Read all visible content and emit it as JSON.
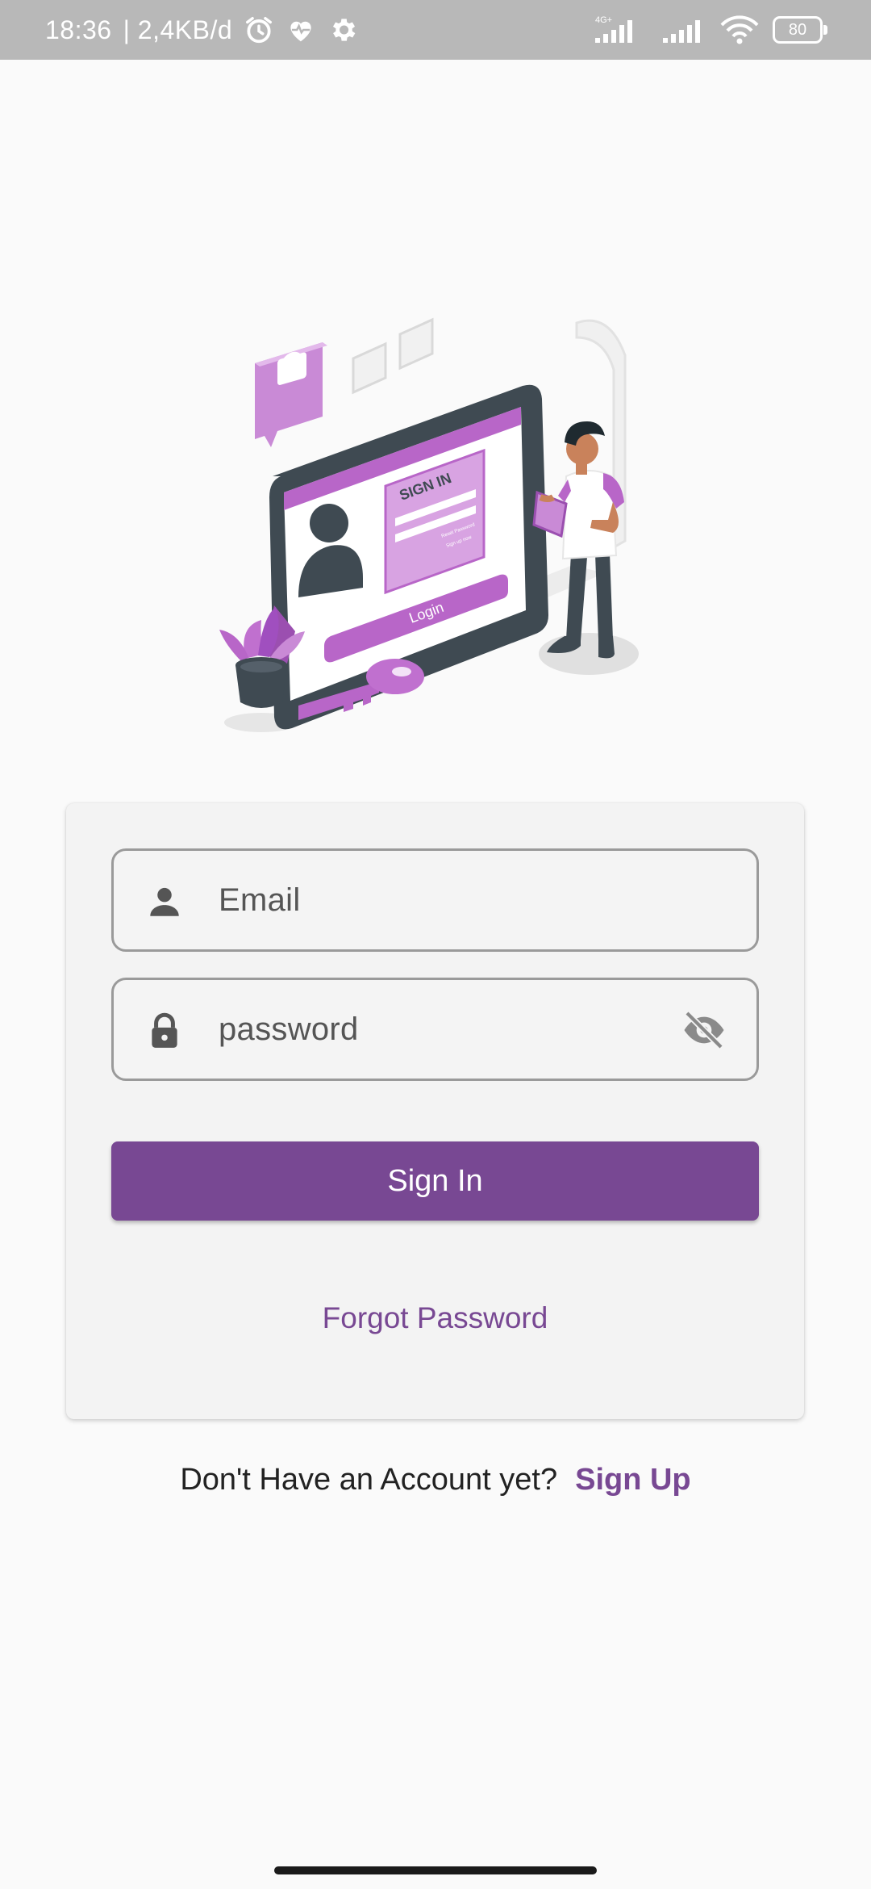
{
  "status_bar": {
    "time": "18:36",
    "net_speed": "| 2,4KB/d",
    "network_type": "4G+",
    "battery": "80",
    "icons": [
      "alarm-icon",
      "heart-health-icon",
      "gear-icon",
      "signal-icon",
      "signal-icon",
      "wifi-icon",
      "battery-icon"
    ]
  },
  "illustration": {
    "sign_in_heading": "SIGN IN",
    "login_label": "Login",
    "reset_text": "Reset Password",
    "signup_text": "Sign up now"
  },
  "login_form": {
    "email_placeholder": "Email",
    "password_placeholder": "password",
    "sign_in_label": "Sign In",
    "forgot_password_label": "Forgot Password"
  },
  "footer": {
    "prompt": "Don't Have an Account yet?",
    "sign_up_label": "Sign Up"
  },
  "colors": {
    "accent": "#784893",
    "illustration_purple": "#b866c8",
    "status_bar": "#b8b8b8"
  }
}
